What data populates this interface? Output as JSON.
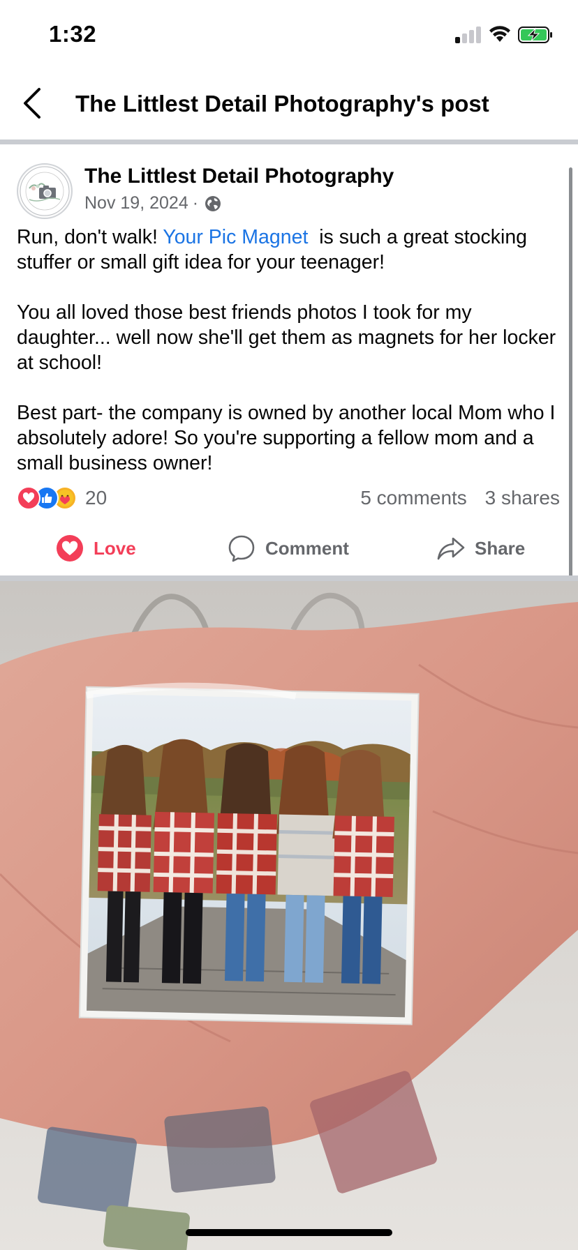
{
  "status_bar": {
    "time": "1:32"
  },
  "header": {
    "title": "The Littlest Detail Photography's post"
  },
  "post": {
    "author": "The Littlest Detail Photography",
    "avatar_text_top": "THE LITTLEST DETAIL",
    "avatar_text_bottom": "PHOTOGRAPHY",
    "date": "Nov 19, 2024",
    "meta_separator": "·",
    "privacy_icon": "globe-icon",
    "text": {
      "p1_before_link": "Run, don't walk! ",
      "p1_link": "Your Pic Magnet",
      "p1_after_link": "  is such a great stocking stuffer or small gift idea for your teenager!",
      "p2": "You all loved those best friends photos I took for my daughter... well now she'll get them as magnets for her locker at school!",
      "p3": "Best part- the company is owned by another local Mom who I absolutely adore! So you're supporting a fellow mom and a small business owner!"
    },
    "reaction_count": "20",
    "comments": "5 comments",
    "shares": "3 shares"
  },
  "actions": {
    "love": "Love",
    "comment": "Comment",
    "share": "Share"
  },
  "colors": {
    "link": "#1b74e4",
    "love": "#f33e58",
    "like": "#1877f2",
    "care": "#f7b125",
    "secondary_text": "#65676b"
  }
}
